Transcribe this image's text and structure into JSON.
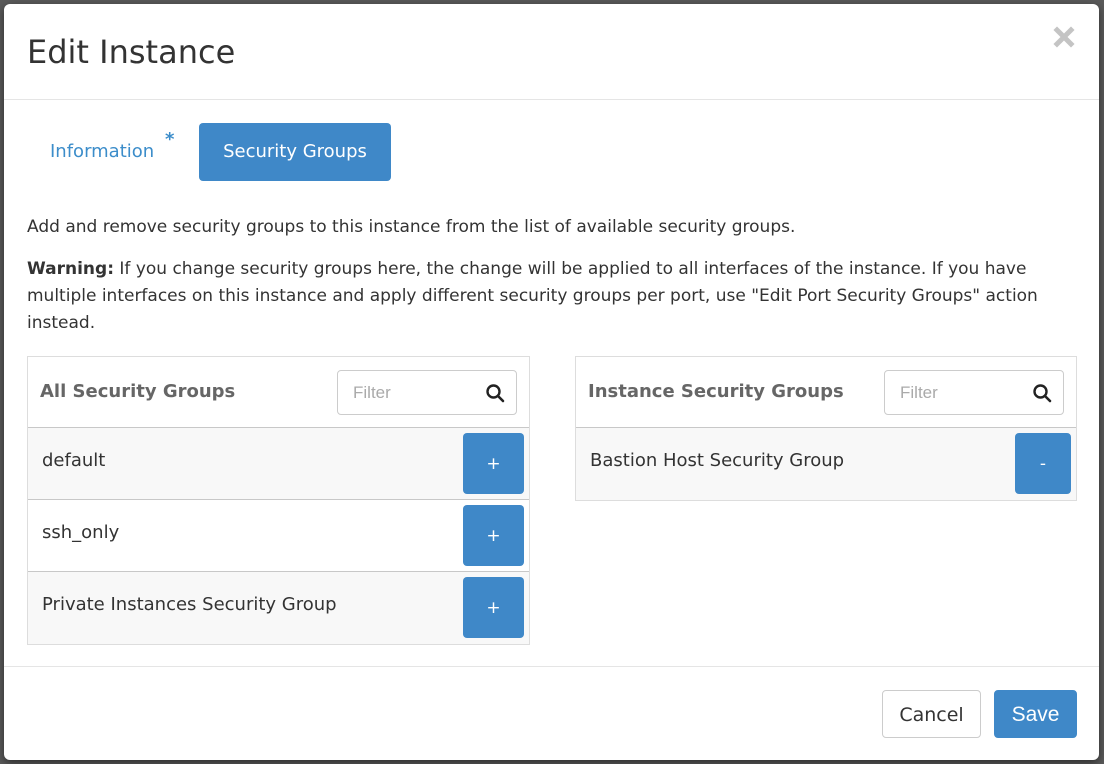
{
  "modal": {
    "title": "Edit Instance",
    "close_icon": "close-icon"
  },
  "tabs": [
    {
      "label": "Information",
      "required_marker": "*",
      "active": false
    },
    {
      "label": "Security Groups",
      "active": true
    }
  ],
  "description": "Add and remove security groups to this instance from the list of available security groups.",
  "warning": {
    "label": "Warning:",
    "text": " If you change security groups here, the change will be applied to all interfaces of the instance. If you have multiple interfaces on this instance and apply different security groups per port, use \"Edit Port Security Groups\" action instead."
  },
  "all_groups": {
    "title": "All Security Groups",
    "filter_placeholder": "Filter",
    "filter_value": "",
    "items": [
      {
        "name": "default",
        "action": "+"
      },
      {
        "name": "ssh_only",
        "action": "+"
      },
      {
        "name": "Private Instances Security Group",
        "action": "+"
      }
    ]
  },
  "instance_groups": {
    "title": "Instance Security Groups",
    "filter_placeholder": "Filter",
    "filter_value": "",
    "items": [
      {
        "name": "Bastion Host Security Group",
        "action": "-"
      }
    ]
  },
  "footer": {
    "cancel_label": "Cancel",
    "save_label": "Save"
  },
  "colors": {
    "primary": "#3f88c8",
    "link": "#3c8dca",
    "row_alt": "#f8f8f8"
  }
}
